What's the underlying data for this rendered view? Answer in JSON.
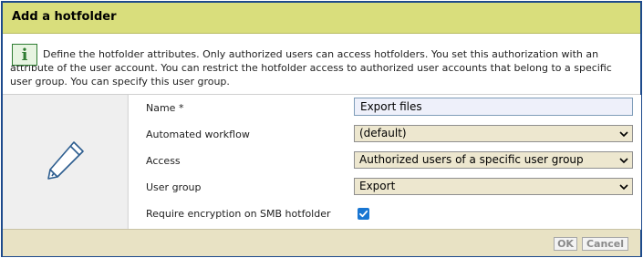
{
  "dialog": {
    "title": "Add a hotfolder"
  },
  "info": {
    "icon": "info-icon",
    "glyph": "i",
    "text": "Define the hotfolder attributes. Only authorized users can access hotfolders. You set this authorization with an attribute of the user account. You can restrict the hotfolder access to authorized user accounts that belong to a specific user group. You can specify this user group."
  },
  "form": {
    "icon": "pencil-icon",
    "name": {
      "label": "Name *",
      "value": "Export files"
    },
    "workflow": {
      "label": "Automated workflow",
      "value": "(default)"
    },
    "access": {
      "label": "Access",
      "value": "Authorized users of a specific user group"
    },
    "user_group": {
      "label": "User group",
      "value": "Export"
    },
    "encryption": {
      "label": "Require encryption on SMB hotfolder",
      "checked": true
    }
  },
  "footer": {
    "ok_label": "OK",
    "cancel_label": "Cancel"
  },
  "colors": {
    "title_bar": "#d9de7c",
    "border": "#1d4a8c",
    "footer": "#e8e2c4",
    "select_bg": "#ede7cf",
    "checkbox": "#1976d2",
    "info_icon": "#2f7d32"
  }
}
